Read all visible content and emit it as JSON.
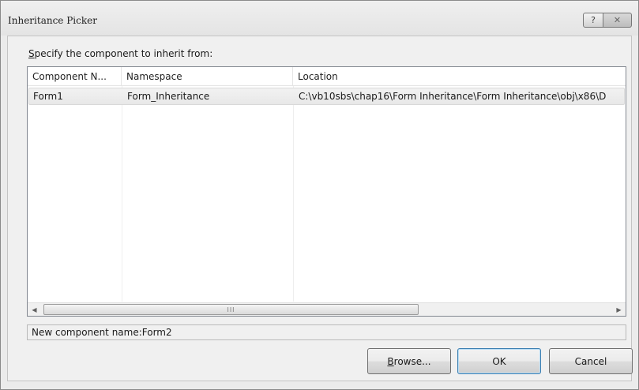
{
  "window": {
    "title": "Inheritance Picker",
    "help_glyph": "?",
    "close_glyph": "✕"
  },
  "instruction": {
    "accel": "S",
    "rest": "pecify the component to inherit from:"
  },
  "table": {
    "columns": [
      "Component N...",
      "Namespace",
      "Location"
    ],
    "rows": [
      {
        "component": "Form1",
        "namespace": "Form_Inheritance",
        "location": "C:\\vb10sbs\\chap16\\Form Inheritance\\Form Inheritance\\obj\\x86\\D"
      }
    ]
  },
  "scrollbar": {
    "left_arrow": "◀",
    "right_arrow": "▶",
    "thumb_grip": "III"
  },
  "new_component_name": "New component name:Form2",
  "buttons": {
    "browse_accel": "B",
    "browse_rest": "rowse...",
    "ok": "OK",
    "cancel": "Cancel"
  }
}
